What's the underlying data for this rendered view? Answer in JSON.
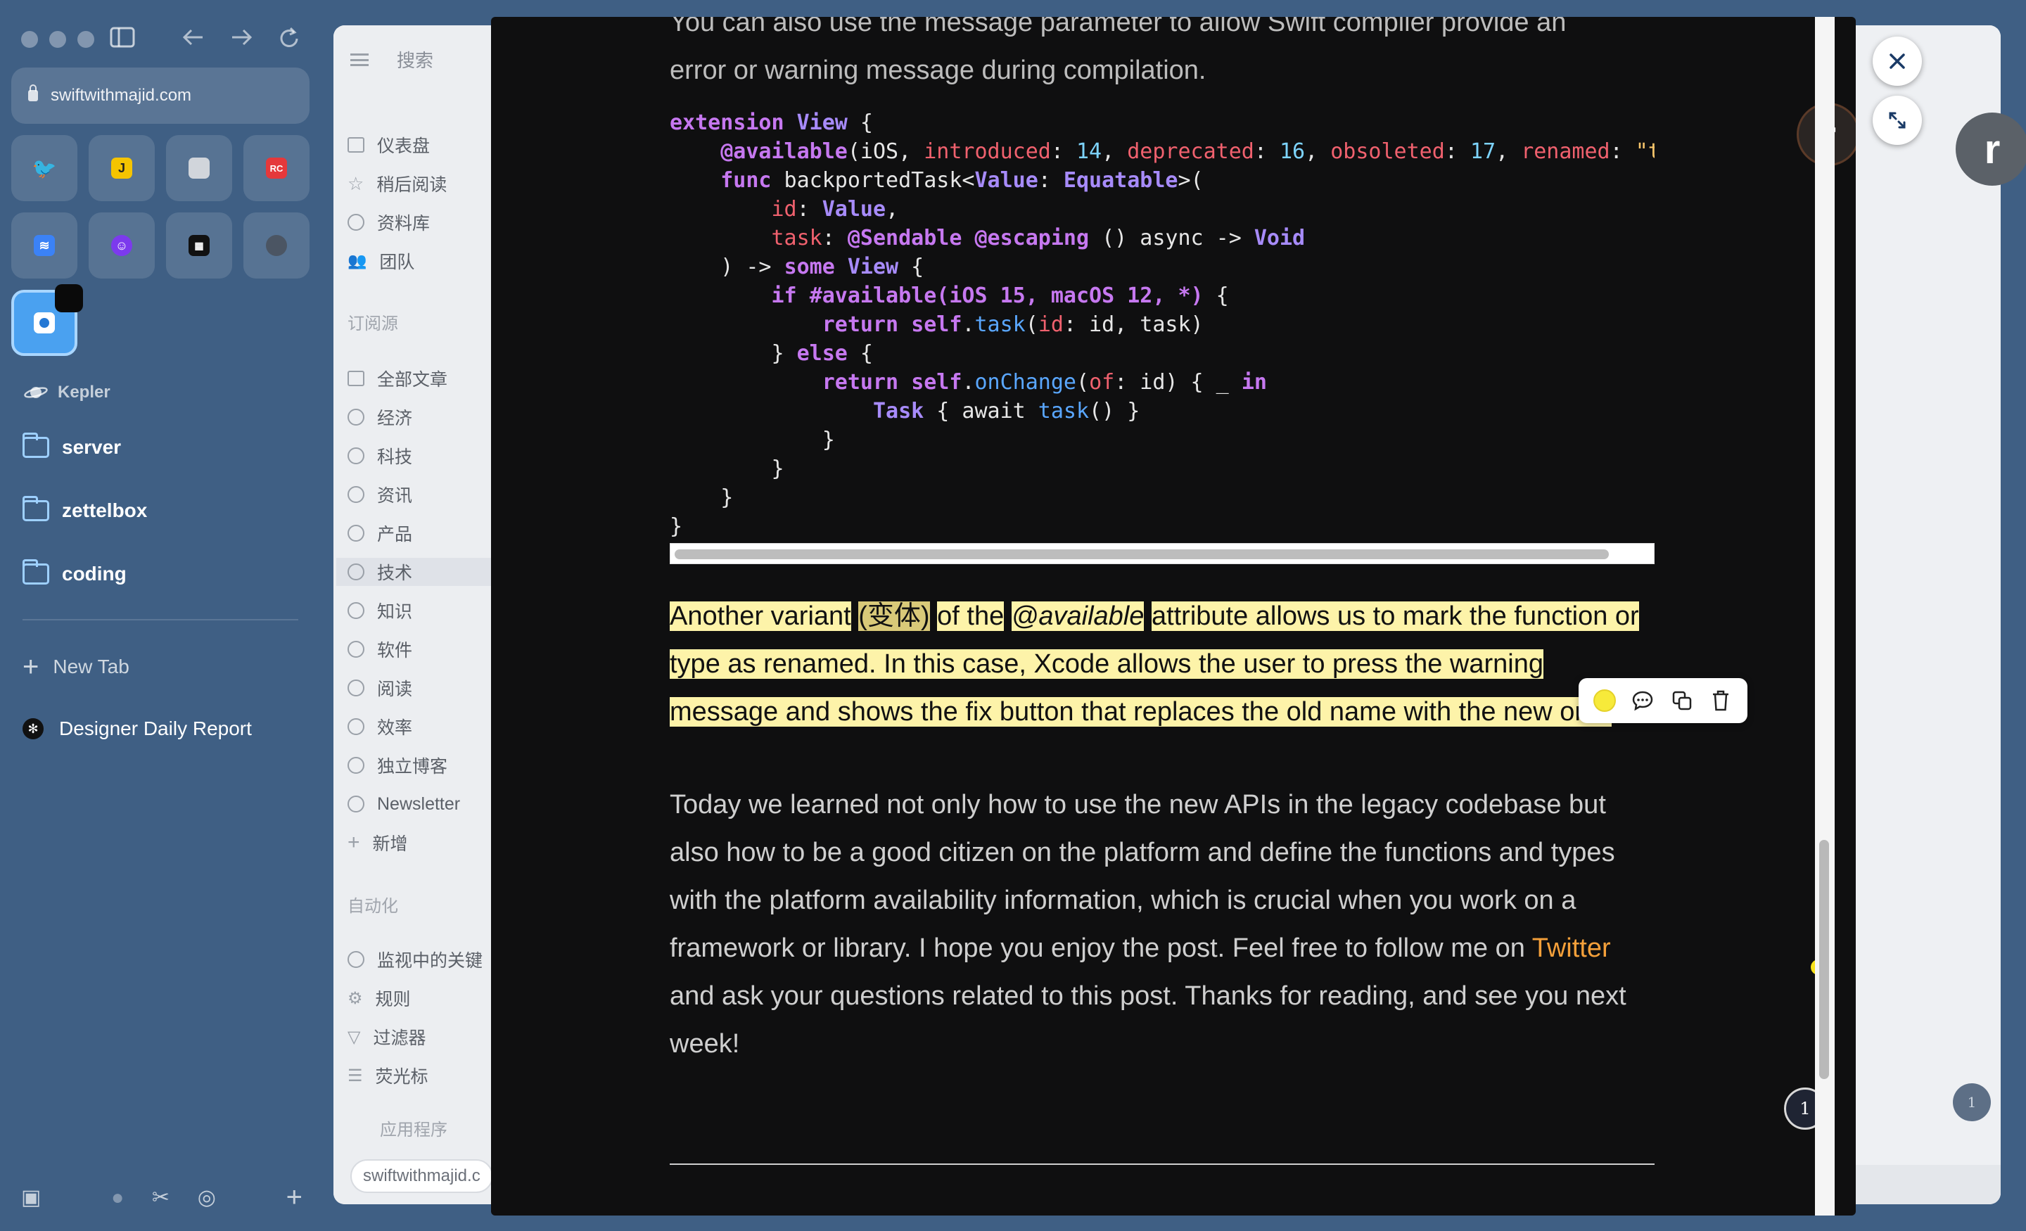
{
  "browser": {
    "url": "swiftwithmajid.com",
    "space_name": "Kepler",
    "folders": [
      "server",
      "zettelbox",
      "coding"
    ],
    "new_tab_label": "New Tab",
    "tab": {
      "title": "Designer Daily Report"
    },
    "favorites": [
      {
        "icon": "twitter-icon",
        "color": "#1d9bf0"
      },
      {
        "icon": "app-j-icon",
        "color": "#f5c400"
      },
      {
        "icon": "box-icon",
        "color": "#6b7280"
      },
      {
        "icon": "rc-icon",
        "color": "#e5383b"
      },
      {
        "icon": "layers-icon",
        "color": "#3b82f6"
      },
      {
        "icon": "bot-icon",
        "color": "#7c3aed"
      },
      {
        "icon": "grid-icon",
        "color": "#111111"
      },
      {
        "icon": "apple-icon",
        "color": "#6b7280"
      }
    ]
  },
  "bg_app": {
    "search_placeholder": "搜索",
    "nav_top": [
      "仪表盘",
      "稍后阅读",
      "资料库",
      "团队"
    ],
    "section_subscriptions": "订阅源",
    "nav_subs": [
      "全部文章",
      "经济",
      "科技",
      "资讯",
      "产品",
      "技术",
      "知识",
      "软件",
      "阅读",
      "效率",
      "独立博客",
      "Newsletter",
      "新增"
    ],
    "active_item": "技术",
    "section_automation": "自动化",
    "nav_auto": [
      "监视中的关键",
      "规则",
      "过滤器",
      "荧光标"
    ],
    "apps_label": "应用程序",
    "footer_chip": "swiftwithmajid.c"
  },
  "reader": {
    "intro_line1": "You can also use the message parameter to allow Swift compiler provide an",
    "intro_line2": "error or warning message during compilation.",
    "highlight": {
      "p1": "Another variant",
      "comment": "(变体)",
      "p2": "of the",
      "p3": "@available",
      "p4": "attribute allows us to mark the function or type as renamed. In this case, Xcode allows the user to press the warning message and shows the fix button that replaces the old name with the new one."
    },
    "closing": {
      "text1": "Today we learned not only how to use the new APIs in the legacy codebase but also how to be a good citizen on the platform and define the functions and types with the platform availability information, which is crucial when you work on a framework or library. I hope you enjoy the post. Feel free to follow me on",
      "link": "Twitter",
      "text2": "and ask your questions related to this post. Thanks for reading, and see you next week!"
    },
    "page_badge": "1",
    "avatar_letter": "r",
    "highlight_color": "#fdf3a9",
    "link_color": "#f5a03a"
  }
}
